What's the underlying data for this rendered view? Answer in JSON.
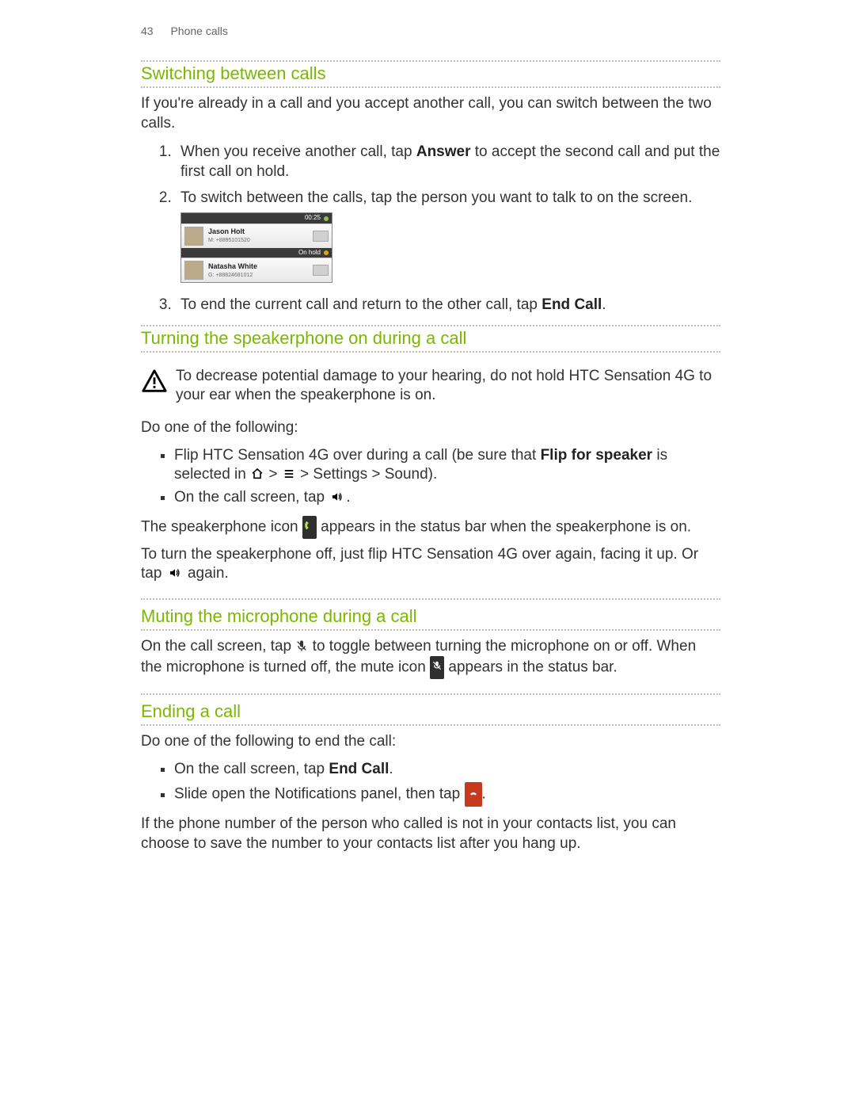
{
  "header": {
    "page_number": "43",
    "section": "Phone calls"
  },
  "s1": {
    "title": "Switching between calls",
    "intro": "If you're already in a call and you accept another call, you can switch between the two calls.",
    "step1_a": "When you receive another call, tap ",
    "step1_b": "Answer",
    "step1_c": " to accept the second call and put the first call on hold.",
    "step2": "To switch between the calls, tap the person you want to talk to on the screen.",
    "step3_a": "To end the current call and return to the other call, tap ",
    "step3_b": "End Call",
    "step3_c": ".",
    "shot": {
      "timer": "00:25",
      "hold_label": "On hold",
      "c1": {
        "name": "Jason Holt",
        "num": "M: +8895101520"
      },
      "c2": {
        "name": "Natasha White",
        "num": "G: +88824681012"
      }
    }
  },
  "s2": {
    "title": "Turning the speakerphone on during a call",
    "warn": "To decrease potential damage to your hearing, do not hold HTC Sensation 4G to your ear when the speakerphone is on.",
    "lead": "Do one of the following:",
    "b1_a": "Flip HTC Sensation 4G over during a call (be sure that ",
    "b1_b": "Flip for speaker",
    "b1_c": " is selected in ",
    "b1_d": " > ",
    "b1_e": " > Settings > Sound).",
    "b2_a": "On the call screen, tap ",
    "b2_b": ".",
    "after1_a": "The speakerphone icon ",
    "after1_b": " appears in the status bar when the speakerphone is on.",
    "after2_a": "To turn the speakerphone off, just flip HTC Sensation 4G over again, facing it up. Or tap ",
    "after2_b": " again."
  },
  "s3": {
    "title": "Muting the microphone during a call",
    "p_a": "On the call screen, tap ",
    "p_b": " to toggle between turning the microphone on or off. When the microphone is turned off, the mute icon ",
    "p_c": " appears in the status bar."
  },
  "s4": {
    "title": "Ending a call",
    "lead": "Do one of the following to end the call:",
    "b1_a": "On the call screen, tap ",
    "b1_b": "End Call",
    "b1_c": ".",
    "b2_a": "Slide open the Notifications panel, then tap ",
    "b2_b": ".",
    "tail": "If the phone number of the person who called is not in your contacts list, you can choose to save the number to your contacts list after you hang up."
  }
}
